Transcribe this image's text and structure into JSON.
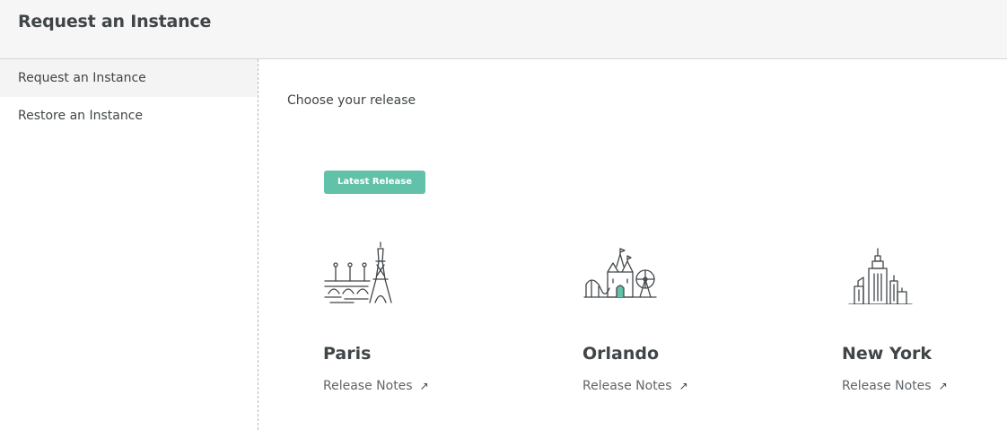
{
  "header": {
    "title": "Request an Instance"
  },
  "sidebar": {
    "items": [
      {
        "label": "Request an Instance",
        "active": true
      },
      {
        "label": "Restore an Instance",
        "active": false
      }
    ]
  },
  "main": {
    "choose_label": "Choose your release",
    "badge": "Latest Release",
    "releases": [
      {
        "name": "Paris",
        "notes": "Release Notes",
        "icon": "eiffel-tower-icon"
      },
      {
        "name": "Orlando",
        "notes": "Release Notes",
        "icon": "theme-park-castle-icon"
      },
      {
        "name": "New York",
        "notes": "Release Notes",
        "icon": "empire-state-skyline-icon"
      }
    ],
    "external_link_glyph": "↗"
  },
  "colors": {
    "accent": "#62c1a9",
    "text": "#404548",
    "header_bg": "#f6f6f6",
    "active_item_bg": "#f4f4f4"
  }
}
